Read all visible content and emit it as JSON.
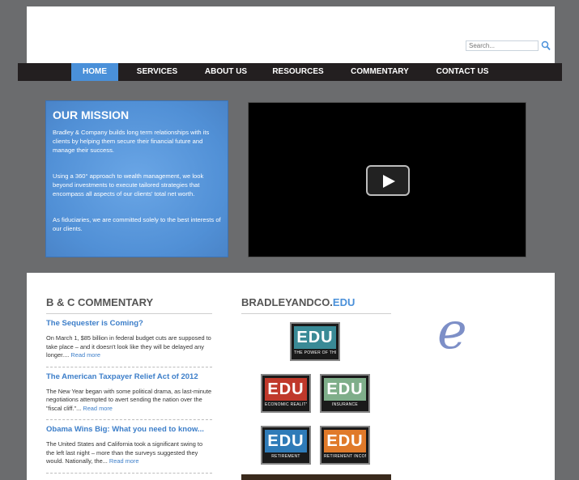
{
  "header": {
    "search_placeholder": "Search..."
  },
  "nav": {
    "items": [
      {
        "label": "HOME",
        "active": true
      },
      {
        "label": "SERVICES"
      },
      {
        "label": "ABOUT US"
      },
      {
        "label": "RESOURCES"
      },
      {
        "label": "COMMENTARY"
      },
      {
        "label": "CONTACT US"
      }
    ]
  },
  "mission": {
    "title": "OUR MISSION",
    "p1": "Bradley & Company builds long term relationships with its clients by helping them secure their financial future and manage their success.",
    "p2": "Using a 360° approach to wealth management, we look beyond investments to execute tailored strategies that encompass all aspects of our clients' total net worth.",
    "p3": "As fiduciaries, we are committed solely to the best interests of our clients."
  },
  "commentary": {
    "title": "B & C COMMENTARY",
    "read_more": "Read more",
    "posts": [
      {
        "title": "The Sequester is Coming?",
        "excerpt": "On March 1, $85 billion in federal budget cuts are supposed to take place – and it doesn't look like they will be delayed any longer.... "
      },
      {
        "title": "The American Taxpayer Relief Act of 2012",
        "excerpt": "The New Year began with some political drama, as last-minute negotiations attempted to avert sending the nation over the \"fiscal cliff.\"... "
      },
      {
        "title": "Obama Wins Big: What you need to know...",
        "excerpt": "The United States and California took a significant swing to the left last night – more than the surveys suggested they would. Nationally, the... "
      }
    ]
  },
  "edu": {
    "title_main": "BRADLEYANDCO.",
    "title_accent": "EDU",
    "badges": [
      {
        "text": "EDU",
        "caption": "THE POWER OF THE ENTREPRENEUR",
        "color": "#3a8a96"
      },
      {
        "text": "EDU",
        "caption": "ECONOMIC REALITY",
        "color": "#c0392b"
      },
      {
        "text": "EDU",
        "caption": "INSURANCE",
        "color": "#7fae8a"
      },
      {
        "text": "EDU",
        "caption": "RETIREMENT",
        "color": "#2f7bb8"
      },
      {
        "text": "EDU",
        "caption": "RETIREMENT INCOME",
        "color": "#e07a2a"
      }
    ]
  },
  "e_logo": {
    "letter": "e"
  }
}
